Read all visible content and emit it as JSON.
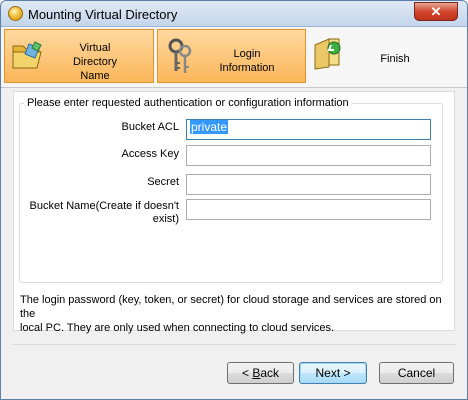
{
  "window": {
    "title": "Mounting Virtual Directory",
    "close_label": "✕"
  },
  "steps": [
    {
      "line1": "Virtual",
      "line2": "Directory",
      "line3": "Name",
      "icon": "folder-open-icon",
      "state": "active"
    },
    {
      "line1": "Login",
      "line2": "Information",
      "icon": "keys-icon",
      "state": "active"
    },
    {
      "label": "Finish",
      "icon": "folder-check-icon",
      "state": "inactive"
    }
  ],
  "form": {
    "group_title": "Please enter requested authentication or configuration information",
    "fields": [
      {
        "label": "Bucket ACL",
        "value": "private"
      },
      {
        "label": "Access Key",
        "value": ""
      },
      {
        "label": "Secret",
        "value": ""
      },
      {
        "label_line1": "Bucket Name(Create if doesn't",
        "label_line2": "exist)",
        "value": ""
      }
    ]
  },
  "info": {
    "line1": "The login password (key, token, or secret) for cloud storage and services are stored on the",
    "line2": "local PC. They are only used when connecting to cloud services."
  },
  "buttons": {
    "back_prefix": "< ",
    "back_hotkey": "B",
    "back_rest": "ack",
    "next": "Next >",
    "cancel": "Cancel"
  },
  "colors": {
    "active_step": "#fbb65a",
    "title_bar": "#c4d5eb",
    "close_button": "#c0311b",
    "selection": "#3399ff"
  }
}
